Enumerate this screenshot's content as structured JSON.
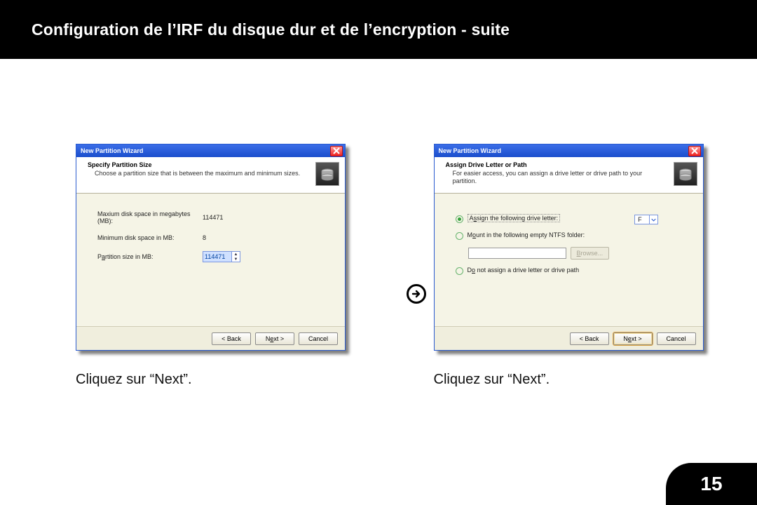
{
  "page": {
    "heading": "Configuration de l’IRF du disque dur et de l’encryption - suite",
    "number": "15"
  },
  "arrow_alt": "next step",
  "dialog_a": {
    "title": "New Partition Wizard",
    "header_title": "Specify Partition Size",
    "header_desc": "Choose a partition size that is between the maximum and minimum sizes.",
    "rows": {
      "max_label": "Maxium disk space in megabytes (MB):",
      "max_value": "114471",
      "min_label": "Minimum disk space in MB:",
      "min_value": "8",
      "size_label_pre": "P",
      "size_label_u": "a",
      "size_label_post": "rtition size in MB:",
      "size_value": "114471"
    },
    "buttons": {
      "back": "< Back",
      "next_pre": "N",
      "next_u": "e",
      "next_post": "xt >",
      "cancel": "Cancel"
    },
    "caption": "Cliquez sur “Next”."
  },
  "dialog_b": {
    "title": "New Partition Wizard",
    "header_title": "Assign Drive Letter or Path",
    "header_desc": "For easier access, you can assign a drive letter or drive path to your partition.",
    "opt1_pre": "A",
    "opt1_u": "s",
    "opt1_post": "sign the following drive letter:",
    "drive_letter": "F",
    "opt2_pre": "M",
    "opt2_u": "o",
    "opt2_post": "unt in the following empty NTFS folder:",
    "browse": "Browse...",
    "opt3_pre": "D",
    "opt3_u": "o",
    "opt3_post": " not assign a drive letter or drive path",
    "buttons": {
      "back": "< Back",
      "next_pre": "N",
      "next_u": "e",
      "next_post": "xt >",
      "cancel": "Cancel"
    },
    "caption": "Cliquez sur “Next”."
  }
}
